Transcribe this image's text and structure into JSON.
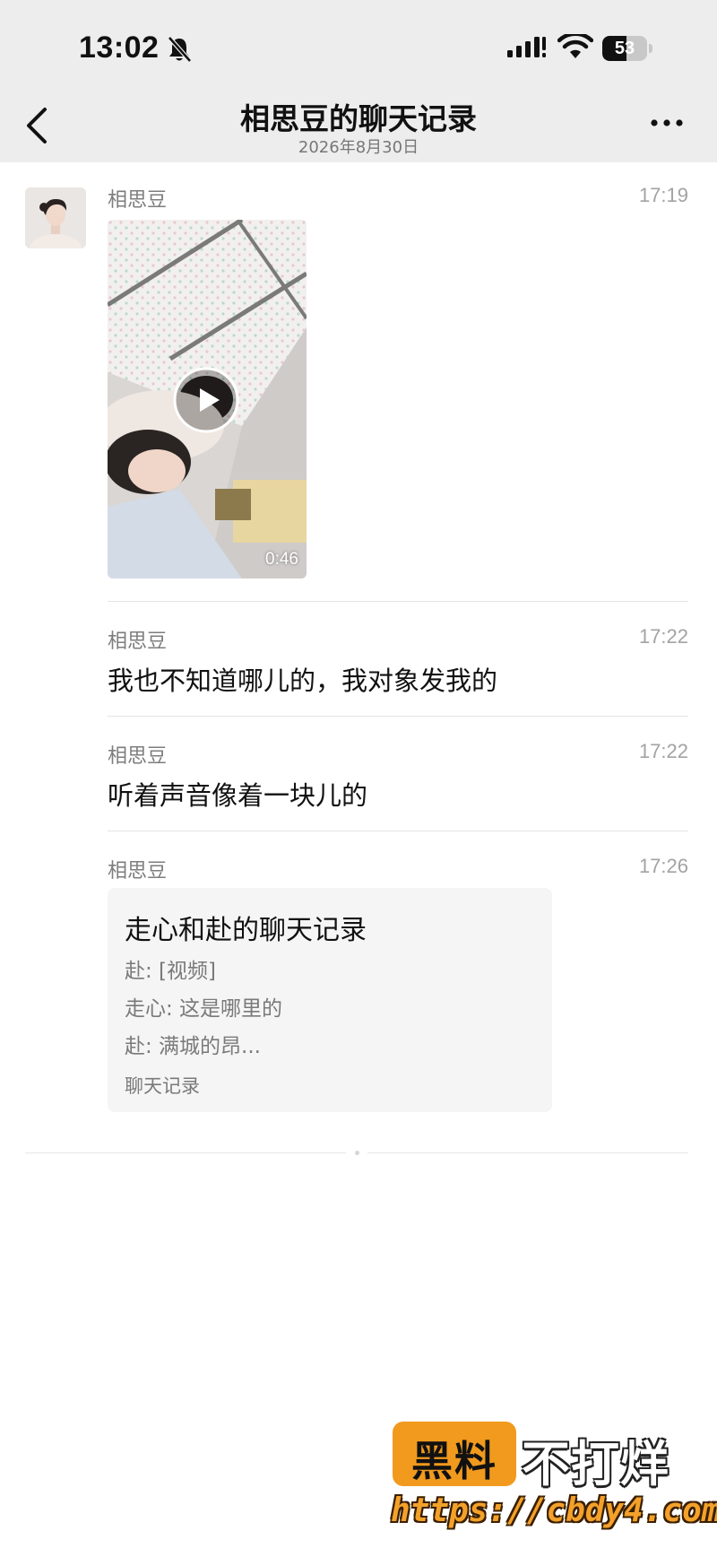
{
  "status_bar": {
    "time": "13:02",
    "battery": "53",
    "battery_level": 0.53
  },
  "nav": {
    "title": "相思豆的聊天记录",
    "subtitle": "2026年8月30日"
  },
  "messages": [
    {
      "sender": "相思豆",
      "time": "17:19",
      "video_duration": "0:46"
    },
    {
      "sender": "相思豆",
      "time": "17:22",
      "text": "我也不知道哪儿的，我对象发我的"
    },
    {
      "sender": "相思豆",
      "time": "17:22",
      "text": "听着声音像着一块儿的"
    },
    {
      "sender": "相思豆",
      "time": "17:26",
      "record": {
        "title": "走心和赴的聊天记录",
        "lines": [
          "赴: [视频]",
          "走心: 这是哪里的",
          "赴: 满城的昂..."
        ],
        "footer": "聊天记录"
      }
    }
  ],
  "watermark": {
    "badge": "黑料",
    "text": "不打烊",
    "url": "https://cbdy4.com"
  }
}
